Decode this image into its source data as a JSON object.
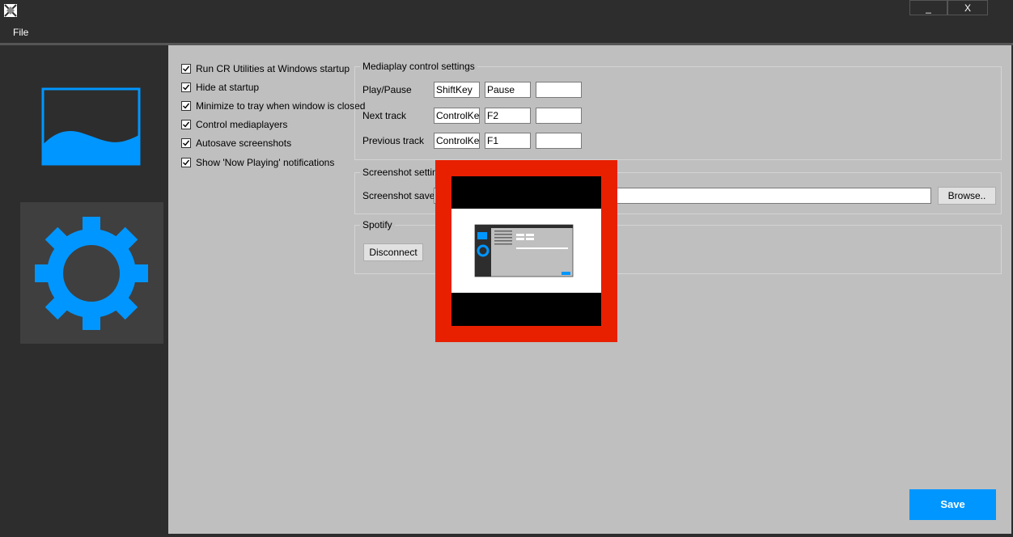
{
  "window": {
    "minimize_label": "_",
    "close_label": "X"
  },
  "menu": {
    "file_label": "File"
  },
  "sidebar": {
    "items": [
      {
        "name": "screenshot",
        "icon": "screenshot-wave-icon"
      },
      {
        "name": "settings",
        "icon": "gear-icon",
        "selected": true
      }
    ],
    "accent_color": "#0096ff"
  },
  "options": {
    "checkboxes": [
      {
        "label": "Run CR Utilities at Windows startup",
        "checked": true
      },
      {
        "label": "Hide at startup",
        "checked": true
      },
      {
        "label": "Minimize to tray when window is closed",
        "checked": true
      },
      {
        "label": "Control mediaplayers",
        "checked": true
      },
      {
        "label": "Autosave screenshots",
        "checked": true
      },
      {
        "label": "Show 'Now Playing' notifications",
        "checked": true
      }
    ]
  },
  "mediaplay": {
    "title": "Mediaplay control settings",
    "rows": [
      {
        "label": "Play/Pause",
        "key1": "ShiftKey",
        "key2": "Pause",
        "key3": ""
      },
      {
        "label": "Next track",
        "key1": "ControlKey",
        "key2": "F2",
        "key3": ""
      },
      {
        "label": "Previous track",
        "key1": "ControlKey",
        "key2": "F1",
        "key3": ""
      }
    ]
  },
  "screenshot": {
    "title": "Screenshot settings",
    "savepath_label": "Screenshot savepa",
    "savepath_value": "",
    "browse_label": "Browse.."
  },
  "spotify": {
    "title": "Spotify",
    "disconnect_label": "Disconnect"
  },
  "save_label": "Save",
  "overlay": {
    "frame_color": "#e82000"
  }
}
